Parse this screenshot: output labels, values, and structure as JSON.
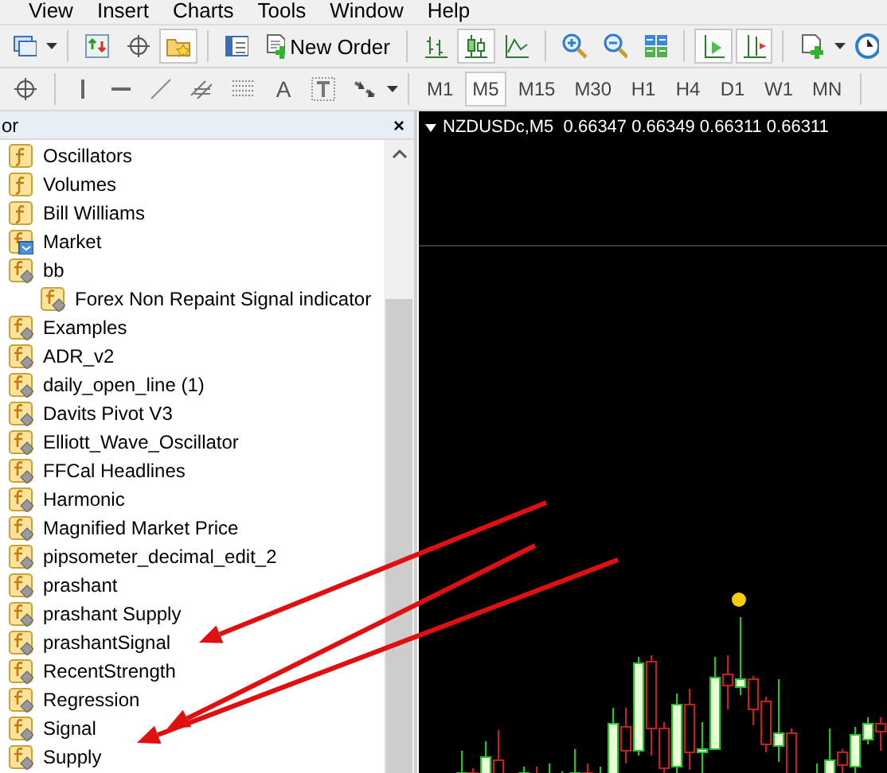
{
  "menu": [
    "View",
    "Insert",
    "Charts",
    "Tools",
    "Window",
    "Help"
  ],
  "toolbar_1": [
    {
      "kind": "profiles",
      "pressed": false
    },
    {
      "kind": "dropdown"
    },
    {
      "kind": "separator"
    },
    {
      "kind": "refresh",
      "pressed": false
    },
    {
      "kind": "crosshair",
      "pressed": false
    },
    {
      "kind": "favorites",
      "pressed": true
    },
    {
      "kind": "separator"
    },
    {
      "kind": "navigator",
      "pressed": false
    },
    {
      "kind": "neworder",
      "label": "New Order",
      "pressed": false
    },
    {
      "kind": "separator"
    },
    {
      "kind": "barchart",
      "pressed": false
    },
    {
      "kind": "candles",
      "pressed": true
    },
    {
      "kind": "linechart",
      "pressed": false
    },
    {
      "kind": "separator"
    },
    {
      "kind": "zoomin",
      "pressed": false
    },
    {
      "kind": "zoomout",
      "pressed": false
    },
    {
      "kind": "tile",
      "pressed": false
    },
    {
      "kind": "separator"
    },
    {
      "kind": "autoscroll",
      "pressed": true
    },
    {
      "kind": "shift",
      "pressed": true
    },
    {
      "kind": "separator"
    },
    {
      "kind": "newchart",
      "pressed": false
    },
    {
      "kind": "dropdown"
    },
    {
      "kind": "clock",
      "pressed": false
    }
  ],
  "toolbar_2": [
    {
      "kind": "crosshair",
      "pressed": false
    },
    {
      "kind": "separator"
    },
    {
      "kind": "vline",
      "pressed": false
    },
    {
      "kind": "hline",
      "pressed": false
    },
    {
      "kind": "trendline",
      "pressed": false
    },
    {
      "kind": "channel",
      "pressed": false
    },
    {
      "kind": "fibo",
      "pressed": false
    },
    {
      "kind": "text",
      "label": "A",
      "pressed": false
    },
    {
      "kind": "textlabel",
      "pressed": false
    },
    {
      "kind": "arrows",
      "pressed": false
    },
    {
      "kind": "dropdown"
    },
    {
      "kind": "separator"
    }
  ],
  "timeframes": [
    {
      "label": "M1",
      "selected": false
    },
    {
      "label": "M5",
      "selected": true
    },
    {
      "label": "M15",
      "selected": false
    },
    {
      "label": "M30",
      "selected": false
    },
    {
      "label": "H1",
      "selected": false
    },
    {
      "label": "H4",
      "selected": false
    },
    {
      "label": "D1",
      "selected": false
    },
    {
      "label": "W1",
      "selected": false
    },
    {
      "label": "MN",
      "selected": false
    }
  ],
  "navigator": {
    "title": "or",
    "close": "×",
    "items": [
      {
        "label": "Oscillators",
        "kind": "folder"
      },
      {
        "label": "Volumes",
        "kind": "folder"
      },
      {
        "label": "Bill Williams",
        "kind": "folder"
      },
      {
        "label": "Market",
        "kind": "market"
      },
      {
        "label": "bb",
        "kind": "custom",
        "children": [
          {
            "label": "Forex Non Repaint Signal indicator",
            "kind": "custom"
          }
        ]
      },
      {
        "label": "Examples",
        "kind": "custom"
      },
      {
        "label": "ADR_v2",
        "kind": "custom"
      },
      {
        "label": "daily_open_line (1)",
        "kind": "custom"
      },
      {
        "label": "Davits Pivot V3",
        "kind": "custom"
      },
      {
        "label": "Elliott_Wave_Oscillator",
        "kind": "custom"
      },
      {
        "label": "FFCal Headlines",
        "kind": "custom"
      },
      {
        "label": "Harmonic",
        "kind": "custom"
      },
      {
        "label": "Magnified Market Price",
        "kind": "custom"
      },
      {
        "label": "pipsometer_decimal_edit_2",
        "kind": "custom"
      },
      {
        "label": "prashant",
        "kind": "custom"
      },
      {
        "label": "prashant Supply",
        "kind": "custom"
      },
      {
        "label": "prashantSignal",
        "kind": "custom"
      },
      {
        "label": "RecentStrength",
        "kind": "custom"
      },
      {
        "label": "Regression",
        "kind": "custom"
      },
      {
        "label": "Signal",
        "kind": "custom"
      },
      {
        "label": "Supply",
        "kind": "custom"
      }
    ]
  },
  "chart": {
    "title": "NZDUSDc,M5  0.66347 0.66349 0.66311 0.66311"
  }
}
